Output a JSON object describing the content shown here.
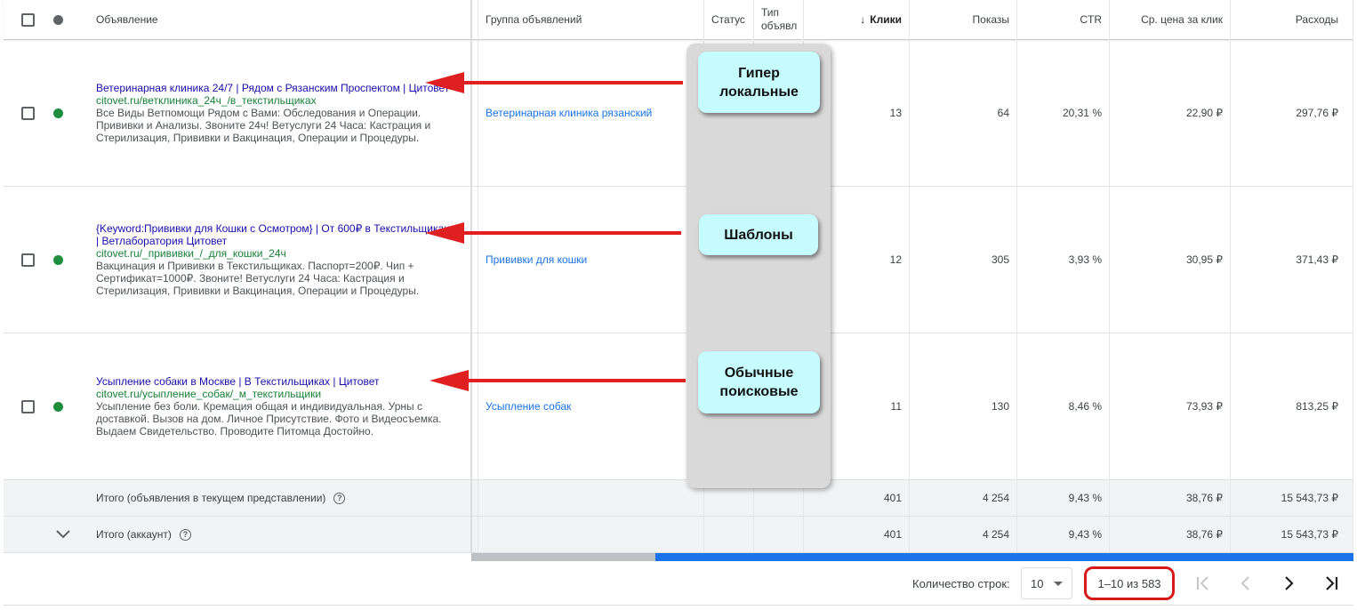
{
  "header": {
    "ad": "Объявление",
    "adgroup": "Группа объявлений",
    "status": "Статус",
    "type": "Тип объявл",
    "clicks": "Клики",
    "impressions": "Показы",
    "ctr": "CTR",
    "avg_cpc": "Ср. цена за клик",
    "cost": "Расходы"
  },
  "ads": [
    {
      "title": "Ветеринарная клиника 24/7 | Рядом с Рязанским Проспектом | Цитовет",
      "url": "citovet.ru/ветклиника_24ч_/в_текстильщиках",
      "desc": "Все Виды Ветпомощи Рядом с Вами: Обследования и Операции. Прививки и Анализы. Звоните 24ч! Ветуслуги 24 Часа: Кастрация и Стерилизация, Прививки и Вакцинация, Операции и Процедуры.",
      "adgroup": "Ветеринарная клиника рязанский",
      "clicks": "13",
      "impressions": "64",
      "ctr": "20,31 %",
      "avg_cpc": "22,90 ₽",
      "cost": "297,76 ₽"
    },
    {
      "title": "{Keyword:Прививки для Кошки с Осмотром} | От 600₽ в Текстильщиках | Ветлаборатория Цитовет",
      "url": "citovet.ru/_прививки_/_для_кошки_24ч",
      "desc": "Вакцинация и Прививки в Текстильщиках. Паспорт=200₽. Чип + Сертификат=1000₽. Звоните! Ветуслуги 24 Часа: Кастрация и Стерилизация, Прививки и Вакцинация, Операции и Процедуры.",
      "adgroup": "Прививки для кошки",
      "clicks": "12",
      "impressions": "305",
      "ctr": "3,93 %",
      "avg_cpc": "30,95 ₽",
      "cost": "371,43 ₽"
    },
    {
      "title": "Усыпление собаки в Москве | В Текстильщиках | Цитовет",
      "url": "citovet.ru/усыпление_собак/_м_текстильщики",
      "desc": "Усыпление без боли. Кремация общая и индивидуальная. Урны с доставкой. Вызов на дом. Личное Присутствие. Фото и Видеосъемка. Выдаем Свидетельство. Проводите Питомца Достойно.",
      "adgroup": "Усыпление собак",
      "clicks": "11",
      "impressions": "130",
      "ctr": "8,46 %",
      "avg_cpc": "73,93 ₽",
      "cost": "813,25 ₽"
    }
  ],
  "totals": [
    {
      "label": "Итого (объявления в текущем представлении)",
      "clicks": "401",
      "impressions": "4 254",
      "ctr": "9,43 %",
      "avg_cpc": "38,76 ₽",
      "cost": "15 543,73 ₽"
    },
    {
      "label": "Итого (аккаунт)",
      "clicks": "401",
      "impressions": "4 254",
      "ctr": "9,43 %",
      "avg_cpc": "38,76 ₽",
      "cost": "15 543,73 ₽"
    }
  ],
  "callouts": {
    "hyperlocal": "Гипер\nлокальные",
    "templates": "Шаблоны",
    "regular": "Обычные\nпоисковые"
  },
  "pagination": {
    "rows_label": "Количество строк:",
    "rows_value": "10",
    "range": "1–10 из 583"
  },
  "colors": {
    "status_enabled": "#1e8e3e",
    "annotation_red": "#e02020",
    "callout_fill": "#c6fcfd"
  }
}
